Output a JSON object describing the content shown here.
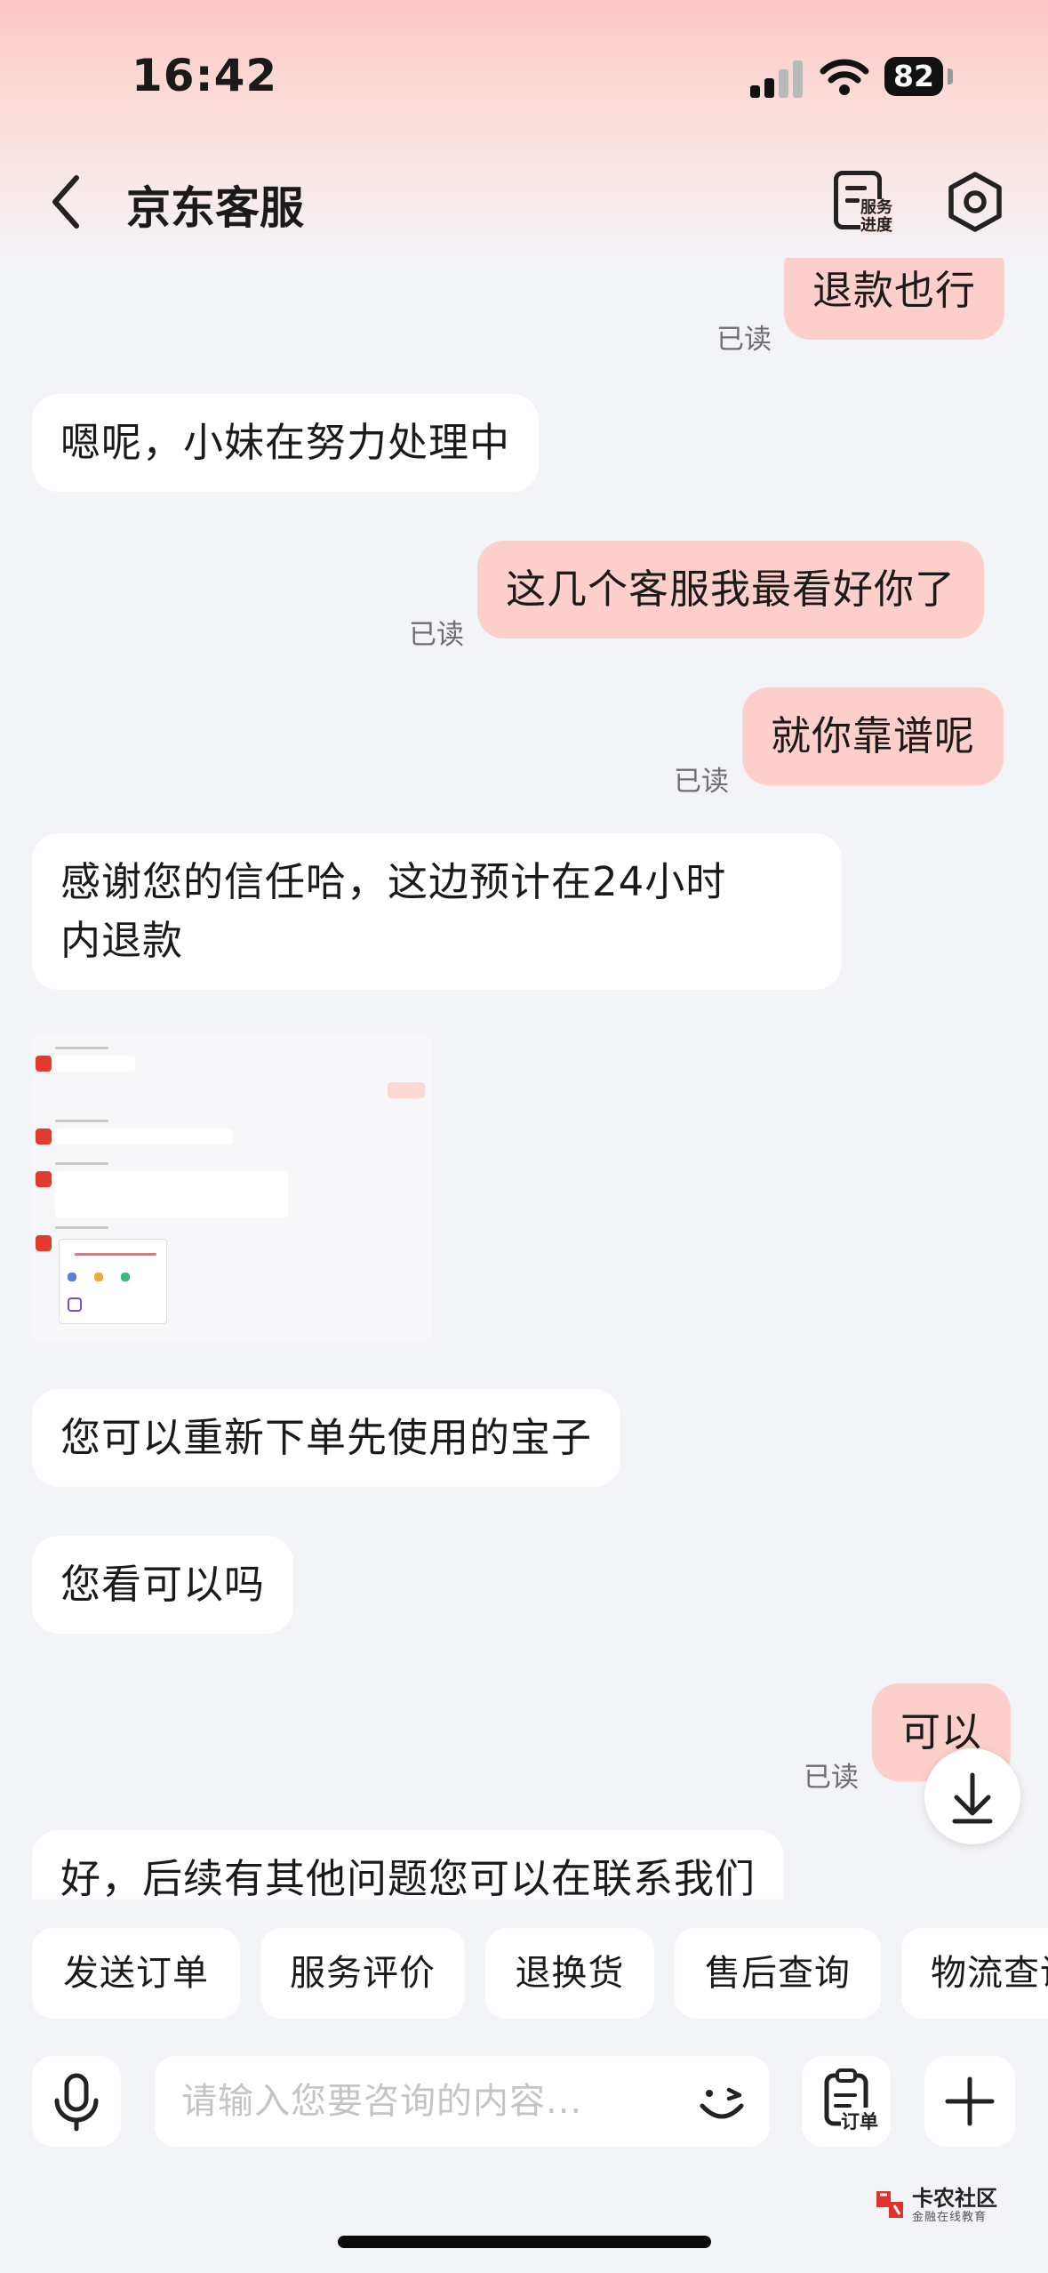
{
  "status_bar": {
    "time": "16:42",
    "battery": "82"
  },
  "nav": {
    "title": "京东客服",
    "progress_label_1": "服务",
    "progress_label_2": "进度"
  },
  "messages": [
    {
      "side": "out",
      "text": "退款也行",
      "status": "已读"
    },
    {
      "side": "in",
      "text": "嗯呢，小妹在努力处理中"
    },
    {
      "side": "out",
      "text": "这几个客服我最看好你了",
      "status": "已读"
    },
    {
      "side": "out",
      "text": "就你靠谱呢",
      "status": "已读"
    },
    {
      "side": "in",
      "text_line1": "感谢您的信任哈，这边预计在24小时",
      "text_line2": "内退款"
    },
    {
      "side": "in",
      "type": "image"
    },
    {
      "side": "in",
      "text": "您可以重新下单先使用的宝子"
    },
    {
      "side": "in",
      "text": "您看可以吗"
    },
    {
      "side": "out",
      "text": "可以",
      "status": "已读"
    },
    {
      "side": "in",
      "text": "好，后续有其他问题您可以在联系我们"
    }
  ],
  "quick_actions": [
    "发送订单",
    "服务评价",
    "退换货",
    "售后查询",
    "物流查询"
  ],
  "input": {
    "placeholder": "请输入您要咨询的内容...",
    "order_label": "订单"
  },
  "watermark": {
    "title": "卡农社区",
    "subtitle": "金融在线教育"
  },
  "colors": {
    "accent": "#fdcfca",
    "header_gradient": "#fcc9c4",
    "background": "#f3f4f8"
  }
}
